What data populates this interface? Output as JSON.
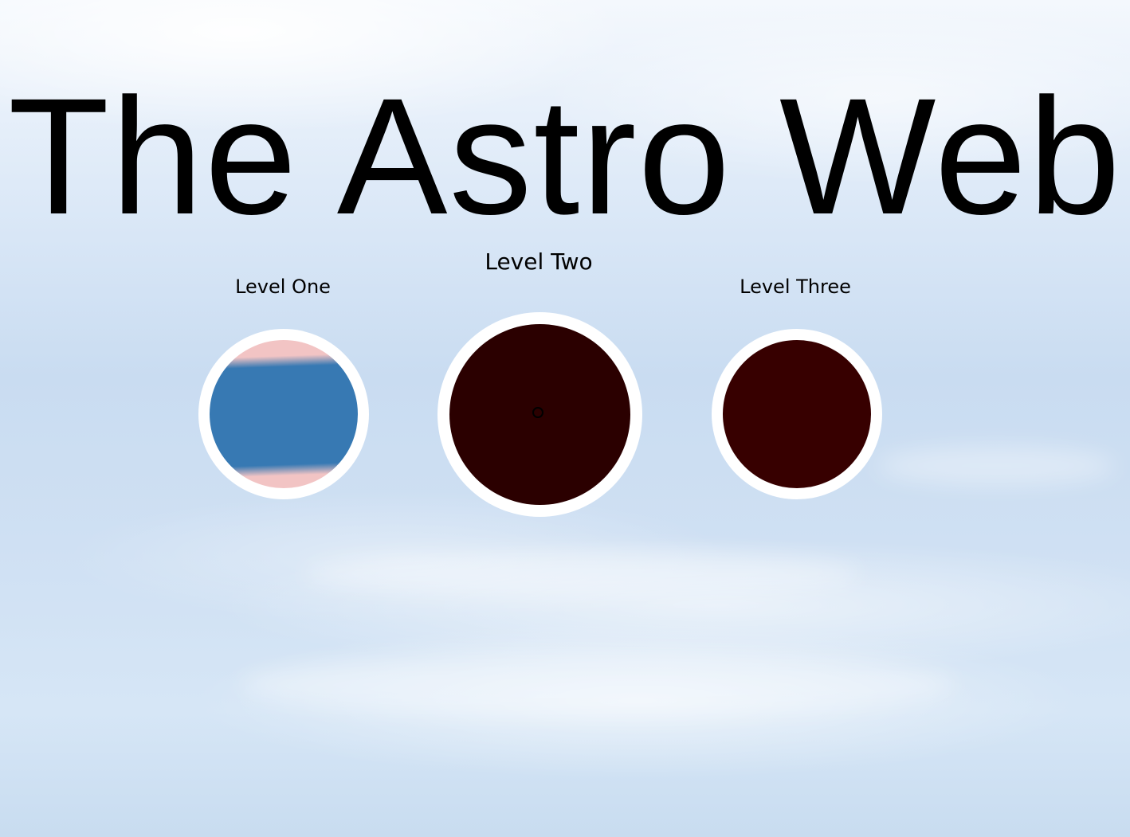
{
  "page": {
    "title": "The Astro Web",
    "background": "sky-with-clouds"
  },
  "levels": [
    {
      "label": "Level One",
      "inner_color": "#3779b3",
      "accent_color": "#f2c4c4",
      "ring_color": "#ffffff",
      "thumbnail": "blue-band-with-pink-edges"
    },
    {
      "label": "Level Two",
      "inner_color": "#2b0000",
      "ring_color": "#ffffff",
      "thumbnail": "dark-maroon"
    },
    {
      "label": "Level Three",
      "inner_color": "#370000",
      "ring_color": "#ffffff",
      "thumbnail": "dark-maroon"
    }
  ],
  "cursor": {
    "icon": "circle-cursor-icon"
  }
}
